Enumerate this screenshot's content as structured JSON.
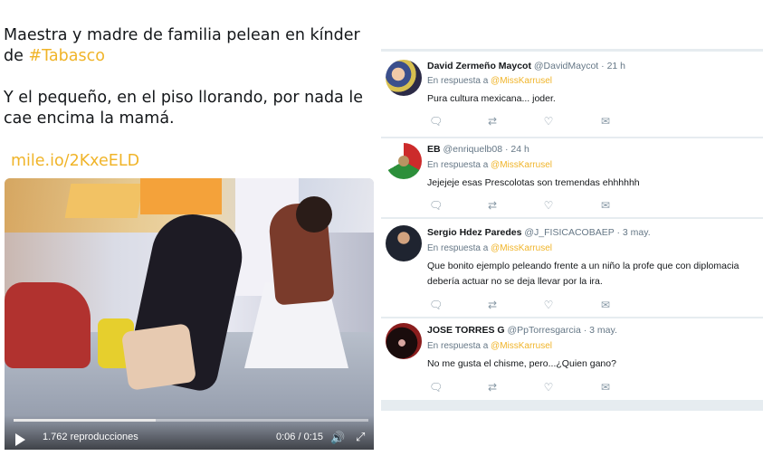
{
  "tweet": {
    "line1": "Maestra y madre de familia pelean en kínder",
    "line2_prefix": "de ",
    "hashtag": "#Tabasco",
    "line3": "Y el pequeño, en el piso llorando, por nada le",
    "line4": "cae encima la mamá.",
    "short_link": "mile.io/2KxeELD"
  },
  "video": {
    "views": "1.762 reproducciones",
    "time": "0:06 / 0:15",
    "progress": 0.4
  },
  "replies": [
    {
      "name": "David Zermeño Maycot",
      "handle": "@DavidMaycot",
      "dot": "·",
      "when": "21 h",
      "reply_prefix": "En respuesta a",
      "mention": "@MissKarrusel",
      "text": "Pura cultura mexicana... joder.",
      "avatar": "avatar-couple"
    },
    {
      "name": "EB",
      "handle": "@enriquelb08",
      "dot": "·",
      "when": "24 h",
      "reply_prefix": "En respuesta a",
      "mention": "@MissKarrusel",
      "text": "Jejejeje esas Prescolotas son tremendas ehhhhhh",
      "avatar": "avatar-mexico-flag"
    },
    {
      "name": "Sergio Hdez Paredes",
      "handle": "@J_FISICACOBAEP",
      "dot": "·",
      "when": "3 may.",
      "reply_prefix": "En respuesta a",
      "mention": "@MissKarrusel",
      "text_line1": "Que bonito ejemplo peleando frente a un niño la profe que con diplomacia",
      "text_line2": "debería actuar no se deja llevar por la ira.",
      "avatar": "avatar-man"
    },
    {
      "name": "JOSE TORRES G",
      "handle": "@PpTorresgarcia",
      "dot": "·",
      "when": "3 may.",
      "reply_prefix": "En respuesta a",
      "mention": "@MissKarrusel",
      "text": "No me gusta el chisme, pero...¿Quien gano?",
      "avatar": "avatar-dark"
    }
  ],
  "icons": {
    "reply": "reply-icon",
    "retweet": "retweet-icon",
    "like": "heart-icon",
    "dm": "envelope-icon"
  },
  "colors": {
    "accent": "#f0b429",
    "muted": "#657786",
    "panel_bg": "#e6ecf0"
  }
}
